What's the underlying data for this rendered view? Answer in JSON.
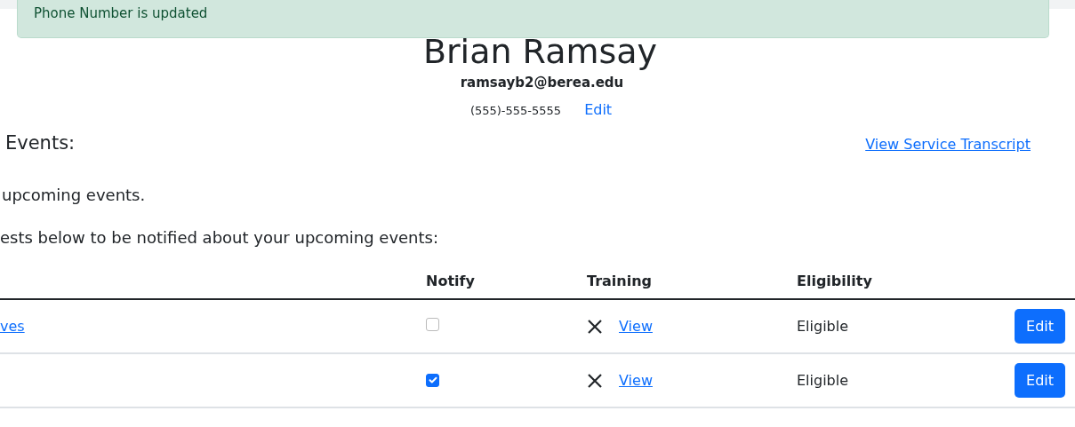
{
  "alert": {
    "text": "Phone Number is updated"
  },
  "profile": {
    "name": "Brian Ramsay",
    "email": "ramsayb2@berea.edu",
    "phone": "(555)-555-5555",
    "phone_edit": "Edit"
  },
  "section_title": "Events:",
  "transcript_link": "View Service Transcript",
  "upcoming_text": "upcoming events.",
  "instruction": "ests below to be notified about your upcoming events:",
  "table": {
    "columns": [
      "Notify",
      "Training",
      "Eligibility"
    ],
    "rows": [
      {
        "event": "ves",
        "notify": false,
        "trained": false,
        "training_link": "View",
        "eligibility": "Eligible",
        "action": "Edit"
      },
      {
        "notify": true,
        "trained": false,
        "training_link": "View",
        "eligibility": "Eligible",
        "action": "Edit"
      }
    ]
  }
}
